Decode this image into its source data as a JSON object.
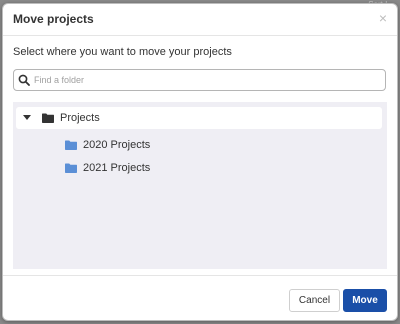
{
  "backdrop": {
    "partial_text": "Sort I..."
  },
  "modal": {
    "title": "Move projects",
    "close_symbol": "×",
    "instruction": "Select where you want to move your projects"
  },
  "search": {
    "placeholder": "Find a folder",
    "value": "",
    "icon": "search-icon"
  },
  "tree": {
    "root": {
      "label": "Projects",
      "expanded": true,
      "icon": "folder-icon",
      "icon_color": "#333333"
    },
    "children": [
      {
        "label": "2020 Projects",
        "icon": "folder-icon",
        "icon_color": "#5b8fd6"
      },
      {
        "label": "2021 Projects",
        "icon": "folder-icon",
        "icon_color": "#5b8fd6"
      }
    ]
  },
  "footer": {
    "cancel_label": "Cancel",
    "move_label": "Move"
  },
  "colors": {
    "primary": "#1a4fa8",
    "tree_background": "#efeef4",
    "child_folder": "#5b8fd6"
  }
}
